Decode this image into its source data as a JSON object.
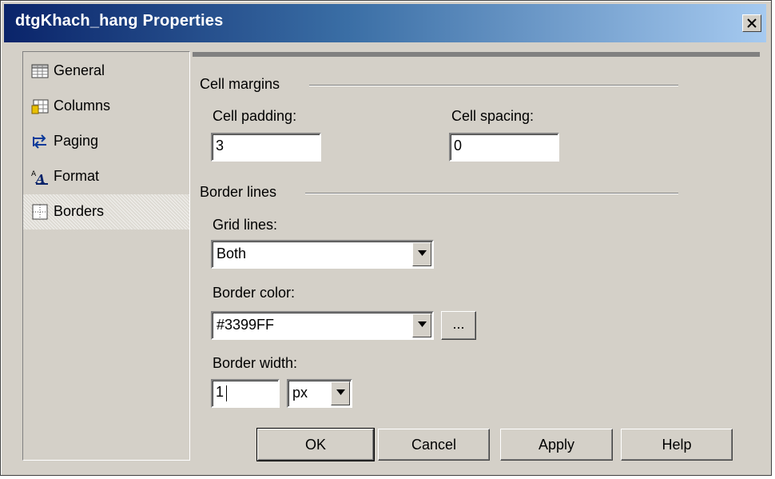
{
  "window": {
    "title": "dtgKhach_hang Properties"
  },
  "sidebar": {
    "items": [
      {
        "label": "General",
        "icon": "grid-icon"
      },
      {
        "label": "Columns",
        "icon": "columns-icon"
      },
      {
        "label": "Paging",
        "icon": "paging-arrows-icon"
      },
      {
        "label": "Format",
        "icon": "format-font-icon"
      },
      {
        "label": "Borders",
        "icon": "borders-icon",
        "selected": true
      }
    ]
  },
  "cell_margins": {
    "section_label": "Cell margins",
    "padding_label": "Cell padding:",
    "padding_value": "3",
    "spacing_label": "Cell spacing:",
    "spacing_value": "0"
  },
  "border_lines": {
    "section_label": "Border lines",
    "grid_lines_label": "Grid lines:",
    "grid_lines_value": "Both",
    "border_color_label": "Border color:",
    "border_color_value": "#3399FF",
    "color_picker_label": "...",
    "border_width_label": "Border width:",
    "border_width_value": "1",
    "border_width_unit": "px"
  },
  "buttons": {
    "ok": "OK",
    "cancel": "Cancel",
    "apply": "Apply",
    "help": "Help"
  },
  "colors": {
    "titlebar_start": "#0a246a",
    "titlebar_end": "#a6caf0",
    "face": "#d4d0c8"
  }
}
